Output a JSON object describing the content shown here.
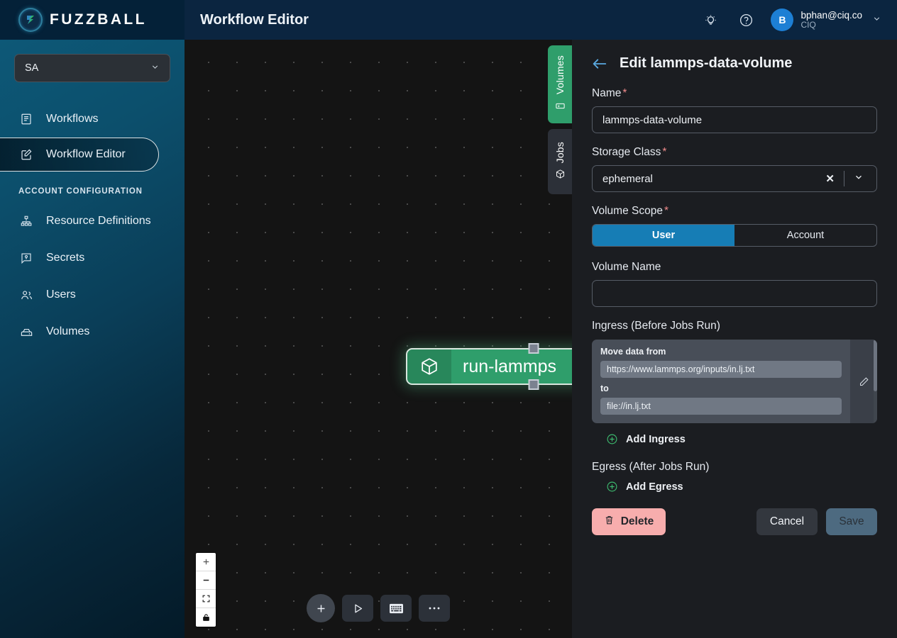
{
  "brand": {
    "name": "FUZZBALL"
  },
  "header": {
    "page_title": "Workflow Editor",
    "bulb_icon": "lightbulb-icon",
    "help_icon": "help-circle-icon",
    "user": {
      "initial": "B",
      "email": "bphan@ciq.co",
      "org": "CIQ"
    }
  },
  "sidebar": {
    "account_select": {
      "value": "SA"
    },
    "items": [
      {
        "label": "Workflows",
        "icon": "list-document-icon",
        "active": false
      },
      {
        "label": "Workflow Editor",
        "icon": "edit-square-icon",
        "active": true
      }
    ],
    "section_label": "ACCOUNT CONFIGURATION",
    "config_items": [
      {
        "label": "Resource Definitions",
        "icon": "sitemap-icon"
      },
      {
        "label": "Secrets",
        "icon": "secret-key-icon"
      },
      {
        "label": "Users",
        "icon": "users-icon"
      },
      {
        "label": "Volumes",
        "icon": "drive-icon"
      }
    ]
  },
  "canvas": {
    "node": {
      "label": "run-lammps",
      "icon": "cube-icon"
    },
    "side_tabs": [
      {
        "label": "Volumes",
        "icon": "volume-icon",
        "active": true
      },
      {
        "label": "Jobs",
        "icon": "cube-outline-icon",
        "active": false
      }
    ],
    "zoom_controls": [
      {
        "name": "zoom-in",
        "glyph": "+"
      },
      {
        "name": "zoom-out",
        "glyph": "−"
      },
      {
        "name": "fit-view",
        "glyph": "fit"
      },
      {
        "name": "lock",
        "glyph": "lock"
      }
    ],
    "toolbar": [
      {
        "name": "add-node-button",
        "icon": "plus-icon"
      },
      {
        "name": "run-workflow-button",
        "icon": "play-icon"
      },
      {
        "name": "keyboard-shortcuts-button",
        "icon": "keyboard-icon"
      },
      {
        "name": "more-options-button",
        "icon": "ellipsis-icon"
      }
    ]
  },
  "panel": {
    "title": "Edit lammps-data-volume",
    "back_icon": "arrow-left-icon",
    "name_field": {
      "label": "Name",
      "required": true,
      "value": "lammps-data-volume"
    },
    "storage_class": {
      "label": "Storage Class",
      "required": true,
      "value": "ephemeral",
      "clear_icon": "close-x-icon",
      "chevron_icon": "chevron-down-icon"
    },
    "volume_scope": {
      "label": "Volume Scope",
      "required": true,
      "options": [
        "User",
        "Account"
      ],
      "selected": "User"
    },
    "volume_name": {
      "label": "Volume Name",
      "value": "",
      "placeholder": ""
    },
    "ingress": {
      "title": "Ingress (Before Jobs Run)",
      "entries": [
        {
          "from_label": "Move data from",
          "from_value": "https://www.lammps.org/inputs/in.lj.txt",
          "to_label": "to",
          "to_value": "file://in.lj.txt",
          "edit_icon": "pencil-icon"
        }
      ],
      "add_label": "Add Ingress"
    },
    "egress": {
      "title": "Egress (After Jobs Run)",
      "add_label": "Add Egress"
    },
    "buttons": {
      "delete": "Delete",
      "delete_icon": "trash-icon",
      "cancel": "Cancel",
      "save": "Save"
    }
  },
  "colors": {
    "accent_blue": "#167db5",
    "node_green": "#2f9e6b",
    "delete_red": "#f7adad",
    "required_star": "#f08b8b"
  }
}
